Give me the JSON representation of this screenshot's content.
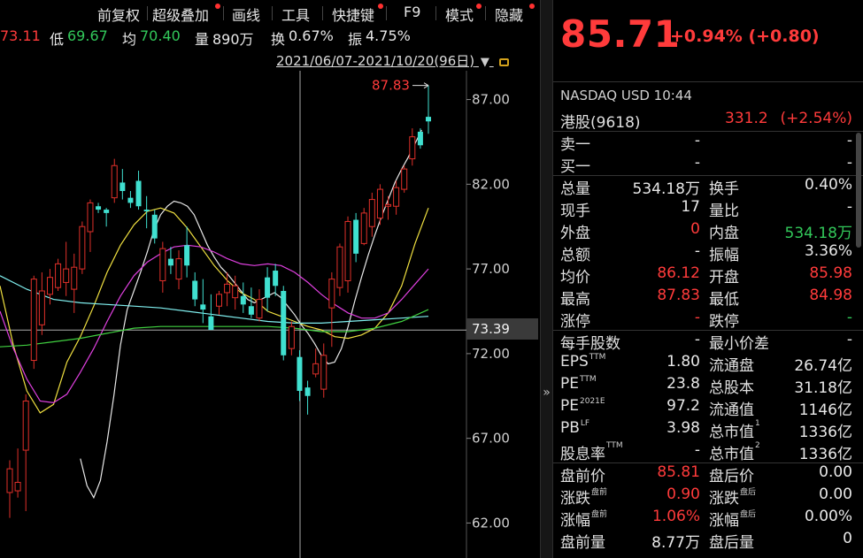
{
  "toolbar": {
    "items": [
      "前复权",
      "超级叠加",
      "画线",
      "工具",
      "快捷键",
      "F9",
      "模式",
      "隐藏"
    ]
  },
  "quote_strip": {
    "high_partial": "73.11",
    "low_label": "低",
    "low_value": "69.67",
    "avg_label": "均",
    "avg_value": "70.40",
    "vol_label": "量",
    "vol_value": "890万",
    "turnover_label": "换",
    "turnover_value": "0.67%",
    "amp_label": "振",
    "amp_value": "4.75%"
  },
  "date_range": "2021/06/07-2021/10/20(96日)",
  "price_tag": "73.39",
  "max_label": "87.83",
  "chart_data": {
    "type": "candlestick",
    "y_ticks": [
      "87.00",
      "82.00",
      "77.00",
      "72.00",
      "67.00",
      "62.00"
    ],
    "ylim": [
      61.5,
      88.7
    ],
    "crosshair_price": 73.39,
    "max_marker": 87.83,
    "candles": [
      {
        "o": 63.8,
        "h": 65.7,
        "l": 62.3,
        "c": 65.2
      },
      {
        "o": 63.9,
        "h": 66.4,
        "l": 63.5,
        "c": 64.4
      },
      {
        "o": 66.3,
        "h": 69.6,
        "l": 62.7,
        "c": 69.2
      },
      {
        "o": 71.6,
        "h": 76.6,
        "l": 71.1,
        "c": 76.4
      },
      {
        "o": 73.7,
        "h": 76.8,
        "l": 73.1,
        "c": 75.7
      },
      {
        "o": 75.5,
        "h": 77.0,
        "l": 74.9,
        "c": 76.5
      },
      {
        "o": 75.9,
        "h": 77.6,
        "l": 75.7,
        "c": 77.3
      },
      {
        "o": 76.2,
        "h": 78.6,
        "l": 75.4,
        "c": 77.0
      },
      {
        "o": 75.8,
        "h": 77.9,
        "l": 74.4,
        "c": 77.1
      },
      {
        "o": 77.0,
        "h": 79.8,
        "l": 76.7,
        "c": 79.5
      },
      {
        "o": 79.2,
        "h": 81.1,
        "l": 78.0,
        "c": 80.9
      },
      {
        "o": 80.7,
        "h": 80.9,
        "l": 80.3,
        "c": 80.5
      },
      {
        "o": 80.5,
        "h": 80.6,
        "l": 79.5,
        "c": 80.3
      },
      {
        "o": 81.2,
        "h": 83.5,
        "l": 80.9,
        "c": 83.1
      },
      {
        "o": 82.1,
        "h": 82.9,
        "l": 81.1,
        "c": 81.6
      },
      {
        "o": 81.2,
        "h": 81.6,
        "l": 80.6,
        "c": 80.9
      },
      {
        "o": 82.2,
        "h": 82.8,
        "l": 80.5,
        "c": 80.7
      },
      {
        "o": 80.5,
        "h": 81.3,
        "l": 79.4,
        "c": 80.4
      },
      {
        "o": 80.2,
        "h": 80.5,
        "l": 78.5,
        "c": 78.8
      },
      {
        "o": 76.3,
        "h": 78.6,
        "l": 75.6,
        "c": 78.2
      },
      {
        "o": 77.6,
        "h": 78.3,
        "l": 76.7,
        "c": 77.2
      },
      {
        "o": 76.4,
        "h": 78.1,
        "l": 75.8,
        "c": 77.6
      },
      {
        "o": 78.4,
        "h": 79.5,
        "l": 76.5,
        "c": 77.2
      },
      {
        "o": 76.3,
        "h": 76.8,
        "l": 74.8,
        "c": 75.2
      },
      {
        "o": 74.9,
        "h": 76.4,
        "l": 73.8,
        "c": 74.6
      },
      {
        "o": 74.2,
        "h": 75.5,
        "l": 73.4,
        "c": 73.4
      },
      {
        "o": 74.8,
        "h": 75.7,
        "l": 74.3,
        "c": 75.5
      },
      {
        "o": 75.6,
        "h": 76.8,
        "l": 74.8,
        "c": 76.1
      },
      {
        "o": 75.3,
        "h": 76.6,
        "l": 74.6,
        "c": 76.0
      },
      {
        "o": 75.4,
        "h": 76.2,
        "l": 74.4,
        "c": 74.9
      },
      {
        "o": 74.8,
        "h": 75.9,
        "l": 74.1,
        "c": 74.3
      },
      {
        "o": 74.1,
        "h": 75.8,
        "l": 73.9,
        "c": 75.2
      },
      {
        "o": 76.5,
        "h": 77.1,
        "l": 74.5,
        "c": 75.3
      },
      {
        "o": 76.9,
        "h": 77.3,
        "l": 75.4,
        "c": 76.0
      },
      {
        "o": 75.7,
        "h": 76.0,
        "l": 71.6,
        "c": 71.9
      },
      {
        "o": 72.3,
        "h": 73.9,
        "l": 71.9,
        "c": 73.6
      },
      {
        "o": 71.8,
        "h": 72.2,
        "l": 69.2,
        "c": 69.8
      },
      {
        "o": 70.0,
        "h": 70.4,
        "l": 68.4,
        "c": 69.5
      },
      {
        "o": 70.8,
        "h": 72.3,
        "l": 70.6,
        "c": 71.4
      },
      {
        "o": 69.9,
        "h": 72.6,
        "l": 69.4,
        "c": 71.9
      },
      {
        "o": 74.7,
        "h": 76.8,
        "l": 72.4,
        "c": 76.4
      },
      {
        "o": 75.9,
        "h": 78.5,
        "l": 75.4,
        "c": 78.3
      },
      {
        "o": 76.3,
        "h": 80.1,
        "l": 75.6,
        "c": 79.8
      },
      {
        "o": 79.9,
        "h": 80.3,
        "l": 77.4,
        "c": 77.9
      },
      {
        "o": 78.5,
        "h": 80.6,
        "l": 78.4,
        "c": 80.3
      },
      {
        "o": 79.5,
        "h": 81.5,
        "l": 78.9,
        "c": 81.1
      },
      {
        "o": 80.0,
        "h": 82.0,
        "l": 79.6,
        "c": 81.7
      },
      {
        "o": 80.7,
        "h": 81.3,
        "l": 79.9,
        "c": 80.8
      },
      {
        "o": 80.7,
        "h": 82.2,
        "l": 80.2,
        "c": 81.8
      },
      {
        "o": 81.7,
        "h": 83.1,
        "l": 81.5,
        "c": 82.9
      },
      {
        "o": 83.5,
        "h": 85.3,
        "l": 83.1,
        "c": 84.8
      },
      {
        "o": 85.1,
        "h": 85.3,
        "l": 84.1,
        "c": 84.3
      },
      {
        "o": 85.98,
        "h": 87.83,
        "l": 84.98,
        "c": 85.71
      }
    ],
    "ma_lines": [
      {
        "color": "#e8e8e8",
        "points": [
          [
            60,
            65.8
          ],
          [
            65,
            64.2
          ],
          [
            70,
            63.5
          ],
          [
            75,
            64.5
          ],
          [
            80,
            66.8
          ],
          [
            85,
            69.5
          ],
          [
            90,
            72.5
          ],
          [
            95,
            74.6
          ],
          [
            100,
            75.7
          ],
          [
            105,
            76.8
          ],
          [
            110,
            78.0
          ],
          [
            115,
            79.3
          ],
          [
            120,
            80.2
          ],
          [
            125,
            80.7
          ],
          [
            130,
            81.0
          ],
          [
            135,
            80.9
          ],
          [
            140,
            80.7
          ],
          [
            145,
            80.2
          ],
          [
            150,
            79.3
          ],
          [
            155,
            78.4
          ],
          [
            160,
            77.7
          ],
          [
            165,
            77.1
          ],
          [
            170,
            76.7
          ],
          [
            175,
            76.2
          ],
          [
            180,
            75.7
          ],
          [
            185,
            75.2
          ],
          [
            190,
            75.0
          ],
          [
            195,
            75.2
          ],
          [
            200,
            75.4
          ],
          [
            205,
            75.6
          ],
          [
            210,
            75.3
          ],
          [
            215,
            74.8
          ],
          [
            220,
            74.3
          ],
          [
            225,
            73.7
          ],
          [
            230,
            73.2
          ],
          [
            235,
            72.6
          ],
          [
            240,
            71.9
          ],
          [
            245,
            71.4
          ],
          [
            250,
            71.5
          ],
          [
            255,
            72.3
          ],
          [
            260,
            73.6
          ],
          [
            265,
            75.1
          ],
          [
            270,
            76.5
          ],
          [
            275,
            77.8
          ],
          [
            280,
            79.0
          ],
          [
            285,
            80.1
          ],
          [
            290,
            81.1
          ],
          [
            295,
            82.1
          ],
          [
            300,
            82.9
          ],
          [
            305,
            83.6
          ],
          [
            310,
            84.4
          ],
          [
            315,
            85.2
          ]
        ]
      },
      {
        "color": "#f0e040",
        "points": [
          [
            0,
            76.0
          ],
          [
            10,
            72.5
          ],
          [
            20,
            69.8
          ],
          [
            30,
            68.5
          ],
          [
            40,
            69.0
          ],
          [
            50,
            71.5
          ],
          [
            60,
            73.0
          ],
          [
            70,
            74.8
          ],
          [
            80,
            76.8
          ],
          [
            90,
            78.4
          ],
          [
            100,
            79.6
          ],
          [
            110,
            80.4
          ],
          [
            120,
            80.6
          ],
          [
            130,
            80.3
          ],
          [
            140,
            79.4
          ],
          [
            150,
            78.3
          ],
          [
            160,
            77.2
          ],
          [
            170,
            76.3
          ],
          [
            180,
            75.6
          ],
          [
            190,
            75.2
          ],
          [
            200,
            74.5
          ],
          [
            210,
            74.2
          ],
          [
            220,
            73.9
          ],
          [
            230,
            73.6
          ],
          [
            240,
            73.4
          ],
          [
            250,
            73.0
          ],
          [
            260,
            72.9
          ],
          [
            270,
            73.1
          ],
          [
            280,
            73.5
          ],
          [
            290,
            74.4
          ],
          [
            300,
            76.0
          ],
          [
            310,
            78.5
          ],
          [
            320,
            80.6
          ]
        ]
      },
      {
        "color": "#e040e0",
        "points": [
          [
            0,
            74.5
          ],
          [
            10,
            72.3
          ],
          [
            20,
            70.5
          ],
          [
            30,
            69.2
          ],
          [
            40,
            69.1
          ],
          [
            50,
            69.6
          ],
          [
            60,
            70.9
          ],
          [
            70,
            72.3
          ],
          [
            80,
            73.9
          ],
          [
            90,
            75.4
          ],
          [
            100,
            76.6
          ],
          [
            110,
            77.4
          ],
          [
            120,
            77.9
          ],
          [
            130,
            78.3
          ],
          [
            140,
            78.4
          ],
          [
            150,
            78.3
          ],
          [
            160,
            78.0
          ],
          [
            170,
            77.6
          ],
          [
            180,
            77.3
          ],
          [
            190,
            77.2
          ],
          [
            200,
            77.3
          ],
          [
            210,
            77.2
          ],
          [
            220,
            76.8
          ],
          [
            230,
            76.2
          ],
          [
            240,
            75.5
          ],
          [
            250,
            74.9
          ],
          [
            260,
            74.4
          ],
          [
            270,
            74.1
          ],
          [
            280,
            74.1
          ],
          [
            290,
            74.4
          ],
          [
            300,
            75.2
          ],
          [
            310,
            76.1
          ],
          [
            320,
            77.0
          ]
        ]
      },
      {
        "color": "#80f0f0",
        "points": [
          [
            0,
            76.6
          ],
          [
            20,
            75.8
          ],
          [
            40,
            75.2
          ],
          [
            60,
            75.0
          ],
          [
            80,
            74.9
          ],
          [
            100,
            74.8
          ],
          [
            120,
            74.7
          ],
          [
            140,
            74.5
          ],
          [
            160,
            74.3
          ],
          [
            180,
            74.1
          ],
          [
            200,
            73.9
          ],
          [
            220,
            73.8
          ],
          [
            240,
            73.8
          ],
          [
            260,
            73.9
          ],
          [
            280,
            74.0
          ],
          [
            300,
            74.1
          ],
          [
            320,
            74.2
          ]
        ]
      },
      {
        "color": "#40d040",
        "points": [
          [
            0,
            72.4
          ],
          [
            20,
            72.5
          ],
          [
            40,
            72.7
          ],
          [
            60,
            72.9
          ],
          [
            80,
            73.2
          ],
          [
            100,
            73.5
          ],
          [
            120,
            73.6
          ],
          [
            140,
            73.6
          ],
          [
            160,
            73.6
          ],
          [
            180,
            73.6
          ],
          [
            200,
            73.6
          ],
          [
            220,
            73.5
          ],
          [
            240,
            73.3
          ],
          [
            260,
            73.3
          ],
          [
            280,
            73.5
          ],
          [
            300,
            73.9
          ],
          [
            320,
            74.6
          ]
        ]
      }
    ]
  },
  "panel": {
    "price": "85.71",
    "change": "+0.94% (+0.80)",
    "exchange_line": "NASDAQ  USD  10:44",
    "hk_row": {
      "label": "港股(9618)",
      "value": "331.2",
      "change": "(+2.54%)"
    },
    "rows": [
      {
        "l1": "卖一",
        "v1": "-",
        "l2": "",
        "v2": "-",
        "c1": "white",
        "c2": "white"
      },
      {
        "l1": "买一",
        "v1": "-",
        "l2": "",
        "v2": "-",
        "c1": "white",
        "c2": "white"
      },
      {
        "l1": "总量",
        "v1": "534.18万",
        "l2": "换手",
        "v2": "0.40%",
        "c1": "white",
        "c2": "white"
      },
      {
        "l1": "现手",
        "v1": "17",
        "l2": "量比",
        "v2": "-",
        "c1": "white",
        "c2": "white"
      },
      {
        "l1": "外盘",
        "v1": "0",
        "l2": "内盘",
        "v2": "534.18万",
        "c1": "red",
        "c2": "green"
      },
      {
        "l1": "总额",
        "v1": "-",
        "l2": "振幅",
        "v2": "3.36%",
        "c1": "white",
        "c2": "white"
      },
      {
        "l1": "均价",
        "v1": "86.12",
        "l2": "开盘",
        "v2": "85.98",
        "c1": "red",
        "c2": "red"
      },
      {
        "l1": "最高",
        "v1": "87.83",
        "l2": "最低",
        "v2": "84.98",
        "c1": "red",
        "c2": "red"
      },
      {
        "l1": "涨停",
        "v1": "-",
        "l2": "跌停",
        "v2": "-",
        "c1": "red",
        "c2": "green"
      },
      {
        "l1": "每手股数",
        "v1": "-",
        "l2": "最小价差",
        "v2": "-",
        "c1": "white",
        "c2": "white"
      },
      {
        "l1": "EPS",
        "s1": "TTM",
        "v1": "1.80",
        "l2": "流通盘",
        "v2": "26.74亿",
        "c1": "white",
        "c2": "white"
      },
      {
        "l1": "PE",
        "s1": "TTM",
        "v1": "23.8",
        "l2": "总股本",
        "v2": "31.18亿",
        "c1": "white",
        "c2": "white"
      },
      {
        "l1": "PE",
        "s1": "2021E",
        "v1": "97.2",
        "l2": "流通值",
        "v2": "1146亿",
        "c1": "white",
        "c2": "white"
      },
      {
        "l1": "PB",
        "s1": "LF",
        "v1": "3.98",
        "l2": "总市值",
        "s2": "1",
        "v2": "1336亿",
        "c1": "white",
        "c2": "white"
      },
      {
        "l1": "股息率",
        "s1": "TTM",
        "v1": "-",
        "l2": "总市值",
        "s2": "2",
        "v2": "1336亿",
        "c1": "white",
        "c2": "white"
      },
      {
        "l1": "盘前价",
        "v1": "85.81",
        "l2": "盘后价",
        "v2": "0.00",
        "c1": "red",
        "c2": "white"
      },
      {
        "l1": "涨跌",
        "s1": "盘前",
        "v1": "0.90",
        "l2": "涨跌",
        "s2": "盘后",
        "v2": "0.00",
        "c1": "red",
        "c2": "white"
      },
      {
        "l1": "涨幅",
        "s1": "盘前",
        "v1": "1.06%",
        "l2": "涨幅",
        "s2": "盘后",
        "v2": "0.00%",
        "c1": "red",
        "c2": "white"
      },
      {
        "l1": "盘前量",
        "v1": "8.77万",
        "l2": "盘后量",
        "v2": "0",
        "c1": "white",
        "c2": "white"
      }
    ]
  },
  "colors": {
    "up": "#e0302a",
    "down": "#40e0d0",
    "red": "#ff3b3b",
    "green": "#32c85a"
  }
}
